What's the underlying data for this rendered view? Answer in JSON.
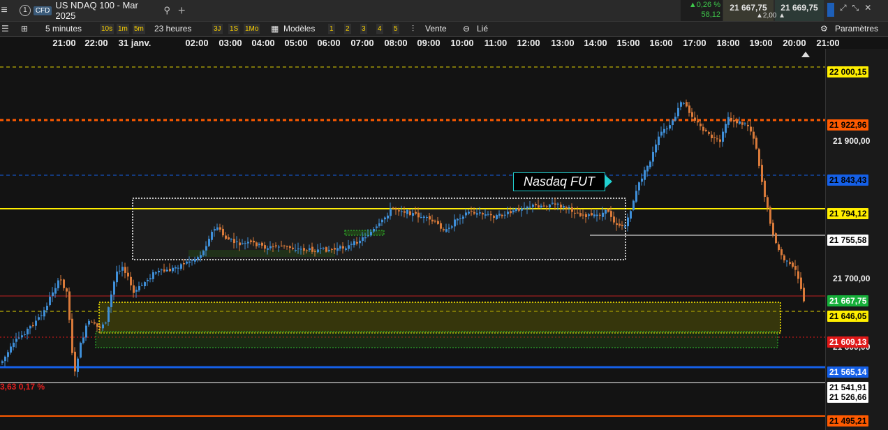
{
  "window": {
    "tab_number": "1",
    "tab_badge": "CFD",
    "tab_title": "US NDAQ 100 - Mar 2025"
  },
  "quote": {
    "change_pct": "▲0,26 %",
    "change_abs": "58,12",
    "bid": "21 667,75",
    "ask": "21 669,75",
    "spread": "▲2,00 ▲"
  },
  "toolbar": {
    "interval": "5 minutes",
    "quick": [
      "10s",
      "1m",
      "5m"
    ],
    "range": "23 heures",
    "quick2": [
      "3J",
      "1S",
      "1Mo"
    ],
    "models": "Modèles",
    "nums": [
      "1",
      "2",
      "3",
      "4",
      "5"
    ],
    "sell": "Vente",
    "linked": "Lié",
    "settings": "Paramètres"
  },
  "time_axis": [
    "21:00",
    "22:00",
    "31 janv.",
    "02:00",
    "03:00",
    "04:00",
    "05:00",
    "06:00",
    "07:00",
    "08:00",
    "09:00",
    "10:00",
    "11:00",
    "12:00",
    "13:00",
    "14:00",
    "15:00",
    "16:00",
    "17:00",
    "18:00",
    "19:00",
    "20:00",
    "21:00"
  ],
  "annotation": "Nasdaq  FUT",
  "left_partial_text": "3,63  0,17 %",
  "price_labels": [
    {
      "value": "22 000,15",
      "bg": "#ffee00",
      "fg": "#000"
    },
    {
      "value": "21 922,96",
      "bg": "#ff5a00",
      "fg": "#000"
    },
    {
      "value": "21 900,00",
      "bg": "",
      "fg": "#eee"
    },
    {
      "value": "21 843,43",
      "bg": "#1560e8",
      "fg": "#000"
    },
    {
      "value": "21 794,12",
      "bg": "#ffee00",
      "fg": "#000"
    },
    {
      "value": "21 755,58",
      "bg": "#ffffff",
      "fg": "#000"
    },
    {
      "value": "21 700,00",
      "bg": "",
      "fg": "#eee"
    },
    {
      "value": "21 667,75",
      "bg": "#16b03a",
      "fg": "#fff"
    },
    {
      "value": "21 646,05",
      "bg": "#ffee00",
      "fg": "#000"
    },
    {
      "value": "21 600,00",
      "bg": "",
      "fg": "#eee"
    },
    {
      "value": "21 609,13",
      "bg": "#e01818",
      "fg": "#fff"
    },
    {
      "value": "21 565,14",
      "bg": "#1560e8",
      "fg": "#fff"
    },
    {
      "value": "21 541,91",
      "bg": "#ffffff",
      "fg": "#000"
    },
    {
      "value": "21 526,66",
      "bg": "#ffffff",
      "fg": "#000"
    },
    {
      "value": "21 495,21",
      "bg": "#ff5a00",
      "fg": "#000"
    }
  ],
  "colors": {
    "up": "#3f8fd8",
    "down": "#d97a3a",
    "accent": "#ffee00"
  }
}
